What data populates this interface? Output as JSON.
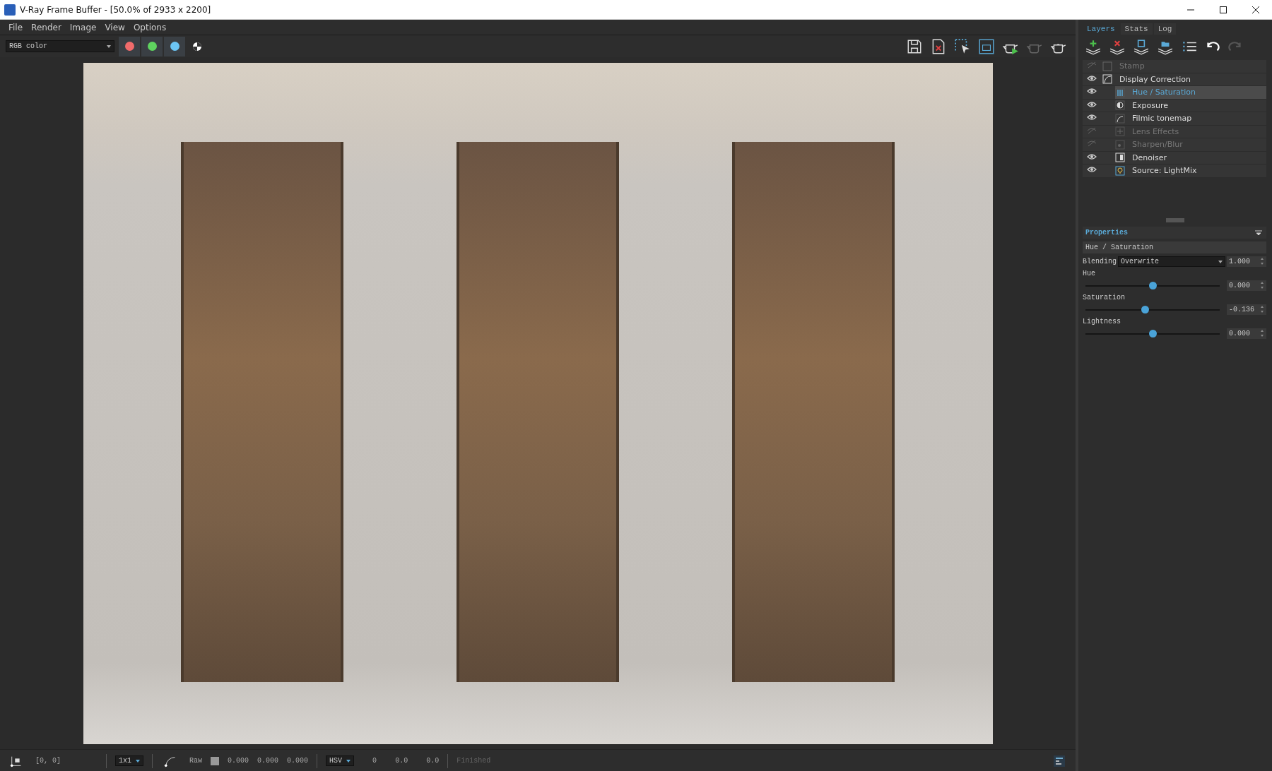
{
  "window": {
    "title": "V-Ray Frame Buffer - [50.0% of 2933 x 2200]"
  },
  "menu": [
    "File",
    "Render",
    "Image",
    "View",
    "Options"
  ],
  "toolbar": {
    "channel": "RGB color",
    "channel_buttons": [
      {
        "color": "#f06b6b"
      },
      {
        "color": "#5fd35f"
      },
      {
        "color": "#6cc6f5"
      }
    ]
  },
  "panel_tabs": [
    {
      "label": "Layers",
      "selected": true
    },
    {
      "label": "Stats",
      "selected": false
    },
    {
      "label": "Log",
      "selected": false
    }
  ],
  "layers": [
    {
      "label": "Stamp",
      "kind": "stamp",
      "enabled": false,
      "selected": false
    },
    {
      "label": "Display Correction",
      "kind": "curve",
      "enabled": true,
      "selected": false,
      "children": [
        {
          "label": "Hue / Saturation",
          "kind": "hue",
          "enabled": true,
          "selected": true
        },
        {
          "label": "Exposure",
          "kind": "exposure",
          "enabled": true,
          "selected": false
        },
        {
          "label": "Filmic tonemap",
          "kind": "tonemap",
          "enabled": true,
          "selected": false
        },
        {
          "label": "Lens Effects",
          "kind": "lens",
          "enabled": false,
          "selected": false
        },
        {
          "label": "Sharpen/Blur",
          "kind": "sharpen",
          "enabled": false,
          "selected": false
        },
        {
          "label": "Denoiser",
          "kind": "denoiser",
          "enabled": true,
          "selected": false
        },
        {
          "label": "Source: LightMix",
          "kind": "lightmix",
          "enabled": true,
          "selected": false
        }
      ]
    }
  ],
  "properties": {
    "heading": "Properties",
    "layer_name": "Hue / Saturation",
    "blending_label": "Blending",
    "blending_mode": "Overwrite",
    "opacity": "1.000",
    "sliders": [
      {
        "label": "Hue",
        "level": 0.5,
        "value": "0.000"
      },
      {
        "label": "Saturation",
        "level": 0.44,
        "value": "-0.136"
      },
      {
        "label": "Lightness",
        "level": 0.5,
        "value": "0.000"
      }
    ]
  },
  "status_bar": {
    "coords": "[0, 0]",
    "sample_size": "1x1",
    "raw_label": "Raw",
    "rgb": [
      "0.000",
      "0.000",
      "0.000"
    ],
    "color_mode": "HSV",
    "hsv": [
      "0",
      "0.0",
      "0.0"
    ],
    "status": "Finished"
  }
}
